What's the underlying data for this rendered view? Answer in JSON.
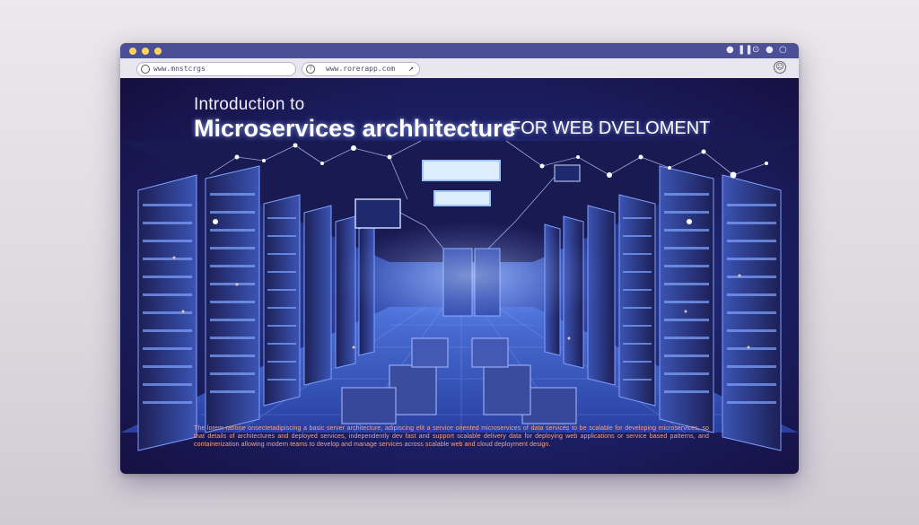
{
  "window": {
    "accent": "#4b4f95",
    "dot_color": "#ffd35b"
  },
  "addressbar": {
    "url_left": "www.mnstcrgs",
    "url_right": "www.rorerapp.com"
  },
  "hero": {
    "line1": "Introduction to",
    "main": "Microservices archhitecture",
    "sub": "FOR WEB DVELOMENT"
  },
  "description": {
    "text": "The lorem ratione onsectetadipiscing a basic server architecture, adipiscing elit a service oriented microservices of data services to be scalable for developing microservices, so that details of architectures and deployed services, independently dev fast and support scalable delivery data for deploying web applications or service based patterns, and containerization allowing modern teams to develop and manage services across scalable web and cloud deployment design."
  },
  "icons": {
    "titlebar_left": [
      "dot",
      "dot",
      "dot"
    ],
    "titlebar_right": [
      "dot-icon",
      "pause-icon",
      "mic-icon",
      "dot-icon",
      "circle-icon"
    ],
    "addressbar": [
      "globe-icon",
      "info-icon",
      "arrow-icon",
      "smiley-icon"
    ]
  }
}
